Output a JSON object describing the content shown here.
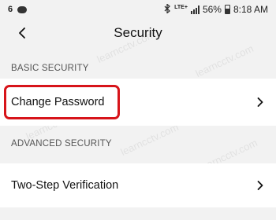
{
  "status_bar": {
    "notification_glyph": "6",
    "network_type": "LTE+",
    "battery_percent": "56%",
    "battery_level": 0.56,
    "time": "8:18 AM"
  },
  "header": {
    "title": "Security",
    "back_icon": "chevron-left-icon"
  },
  "sections": {
    "basic": {
      "label": "BASIC SECURITY",
      "items": [
        {
          "label": "Change Password",
          "icon": "chevron-right-icon",
          "highlighted": true
        }
      ]
    },
    "advanced": {
      "label": "ADVANCED SECURITY",
      "items": [
        {
          "label": "Two-Step Verification",
          "icon": "chevron-right-icon"
        }
      ]
    }
  },
  "watermark": "learncctv.com",
  "colors": {
    "background": "#f2f2f2",
    "row_background": "#ffffff",
    "highlight": "#d7141a",
    "text": "#111111",
    "section_label": "#555555"
  }
}
